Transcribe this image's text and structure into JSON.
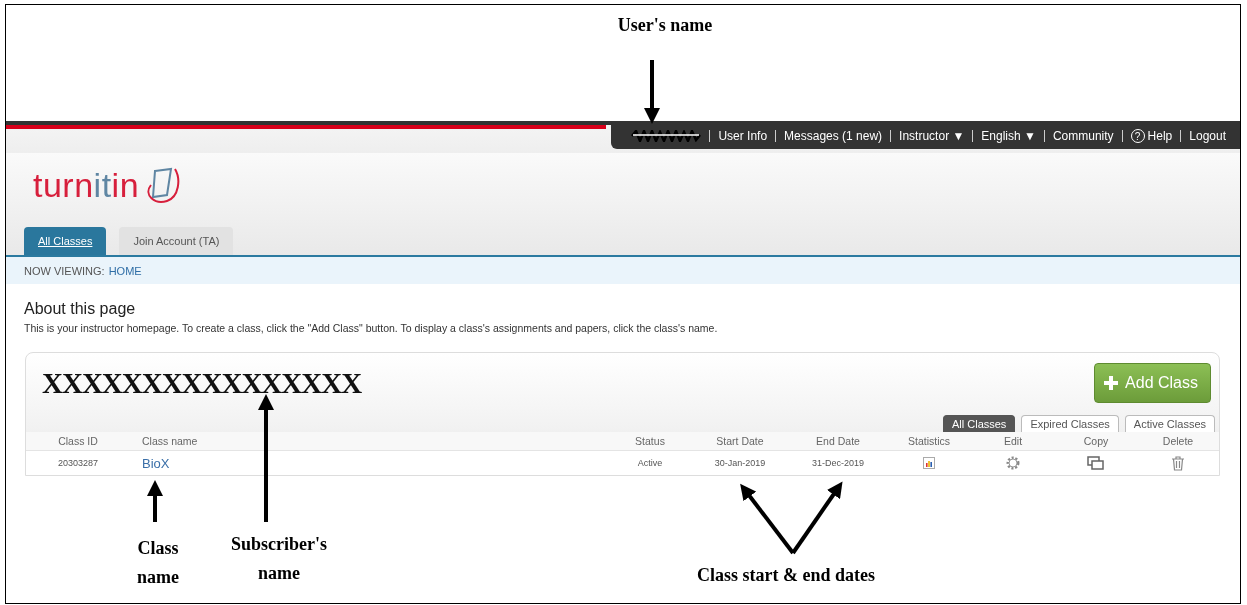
{
  "annotations": {
    "user_name": "User's name",
    "class_name": "Class name",
    "subscriber_name": "Subscriber's name",
    "dates": "Class start & end dates"
  },
  "top_menu": [
    {
      "kind": "redacted"
    },
    {
      "kind": "link",
      "label": "User Info"
    },
    {
      "kind": "link",
      "label": "Messages (1 new)"
    },
    {
      "kind": "link",
      "label": "Instructor ▼"
    },
    {
      "kind": "link",
      "label": "English ▼"
    },
    {
      "kind": "link",
      "label": "Community"
    },
    {
      "kind": "help",
      "label": "Help",
      "icon": "?"
    },
    {
      "kind": "link",
      "label": "Logout"
    }
  ],
  "logo": {
    "parts": [
      "turn",
      "it",
      "in"
    ]
  },
  "tabs": [
    {
      "label": "All Classes",
      "selected": true
    },
    {
      "label": "Join Account (TA)",
      "selected": false
    }
  ],
  "breadcrumb": {
    "prefix": "NOW VIEWING:",
    "link": "HOME"
  },
  "about": {
    "title": "About this page",
    "text": "This is your instructor homepage. To create a class, click the \"Add Class\" button. To display a class's assignments and papers, click the class's name."
  },
  "panel": {
    "subscriber_name": "XXXXXXXXXXXXXXXX",
    "add_button": "Add Class",
    "filter_tabs": [
      {
        "label": "All Classes",
        "selected": true
      },
      {
        "label": "Expired Classes",
        "selected": false
      },
      {
        "label": "Active Classes",
        "selected": false
      }
    ]
  },
  "table": {
    "columns": [
      "Class ID",
      "Class name",
      "Status",
      "Start Date",
      "End Date",
      "Statistics",
      "Edit",
      "Copy",
      "Delete"
    ],
    "rows": [
      {
        "class_id": "20303287",
        "class_name": "BioX",
        "status": "Active",
        "start_date": "30-Jan-2019",
        "end_date": "31-Dec-2019"
      }
    ]
  }
}
